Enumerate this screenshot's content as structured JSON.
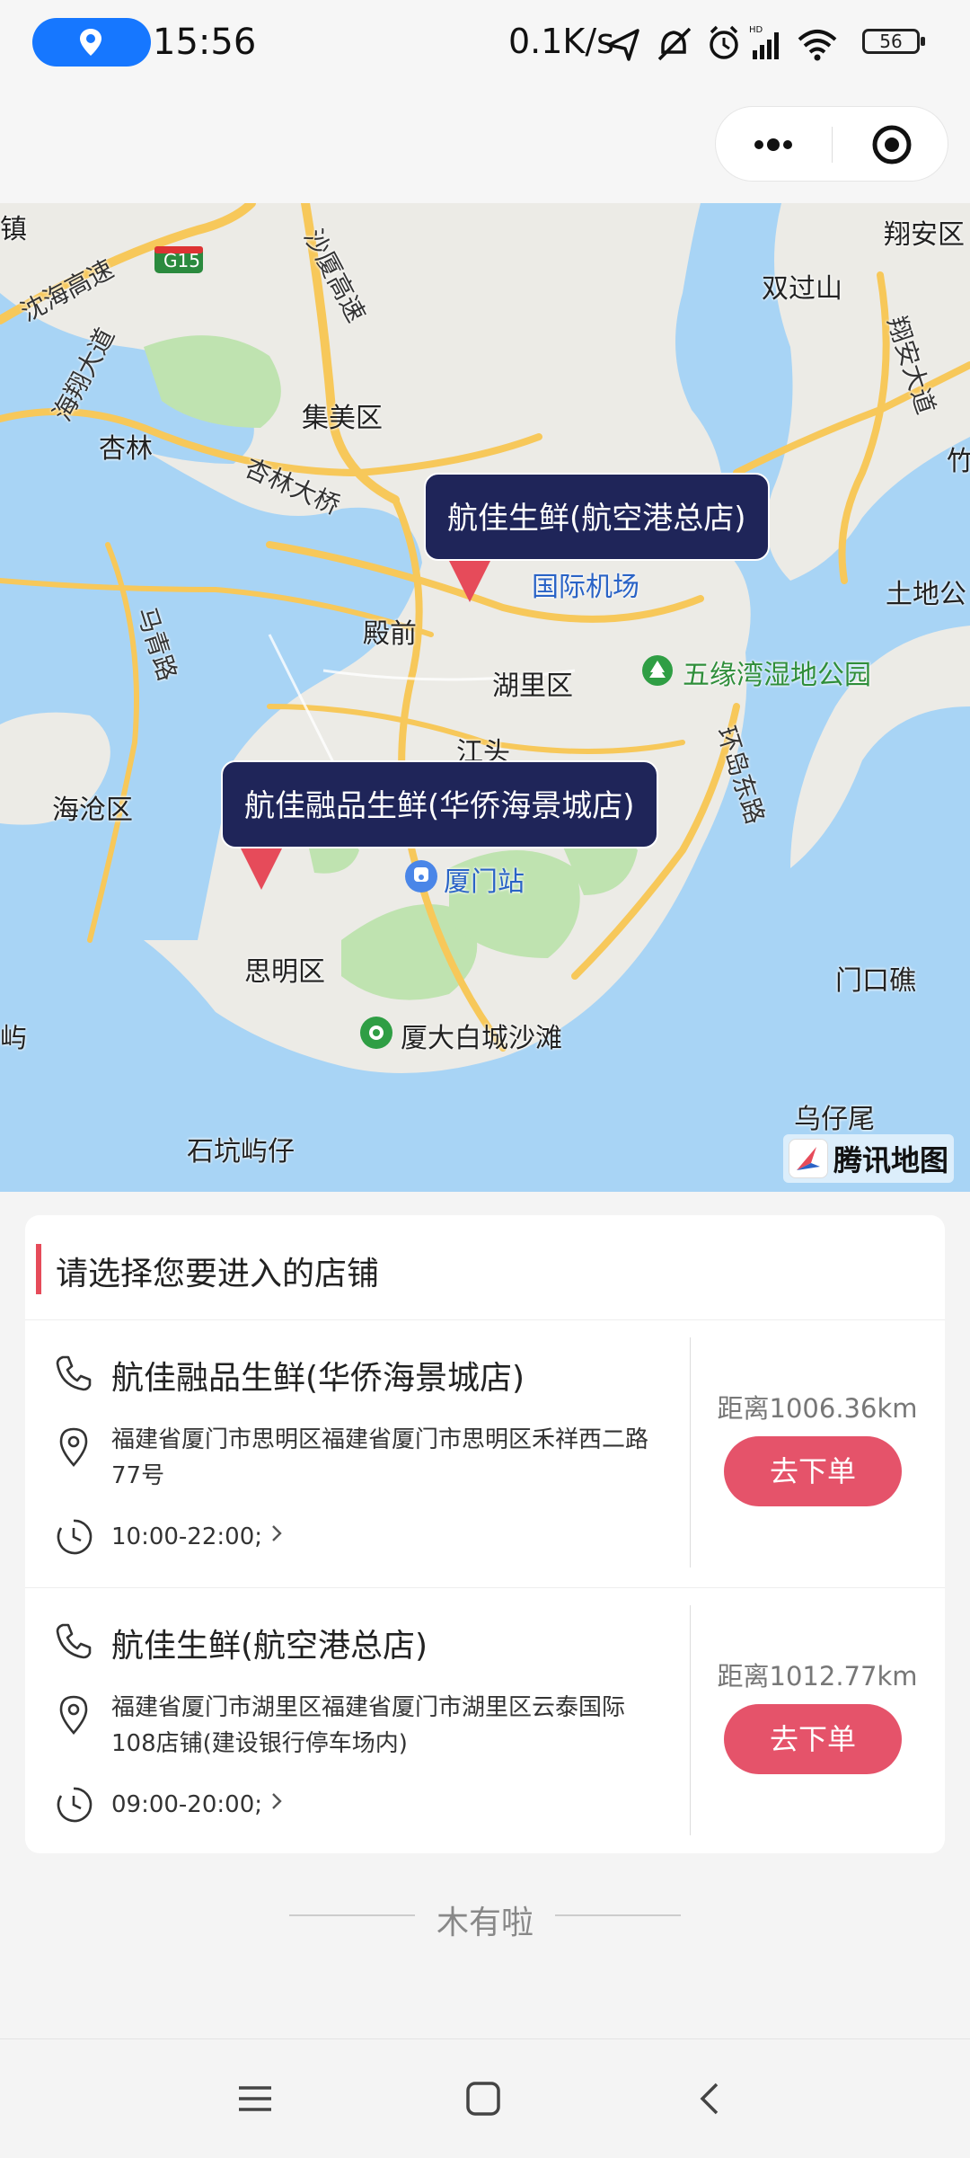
{
  "status_bar": {
    "time": "15:56",
    "net_speed": "0.1K/s",
    "battery": "56",
    "icons": [
      "location-arrow-icon",
      "mute-icon",
      "alarm-icon",
      "signal-icon",
      "wifi-icon",
      "battery-icon"
    ]
  },
  "header": {
    "more_icon": "more-dots-icon",
    "close_icon": "target-circle-icon"
  },
  "map": {
    "labels": {
      "xiangan_district": "翔安区",
      "shuangguoshan": "双过山",
      "jimei_district": "集美区",
      "xinglin": "杏林",
      "xinglin_bridge": "杏林大桥",
      "airport": "国际机场",
      "dianqian": "殿前",
      "huli_district": "湖里区",
      "wuyuanwan_park": "五缘湾湿地公园",
      "jiangtou": "江头",
      "haicang_district": "海沧区",
      "xiamen_station": "厦门站",
      "siming_district": "思明区",
      "xiada_beach": "厦大白城沙滩",
      "menkoujiao": "门口礁",
      "wuzaiwei": "乌仔尾",
      "shikeng": "石坑屿仔",
      "tudigong": "土地公",
      "shenhai_expressway": "沈海高速",
      "xiangan_avenue": "翔安大道",
      "xiangtian": "海翔大道",
      "maqing_road": "马青路",
      "huandao_east": "环岛东路",
      "xiasha_expressway": "沙厦高速",
      "g15": "G15",
      "edge_zhen": "镇",
      "edge_yu": "屿",
      "edge_zhu": "竹"
    },
    "callouts": [
      "航佳生鲜(航空港总店)",
      "航佳融品生鲜(华侨海景城店)"
    ],
    "watermark": "腾讯地图",
    "colors": {
      "water": "#a8d4f5",
      "land": "#ecebe6",
      "road_major": "#f7c85a",
      "green": "#bfe3b0",
      "callout_bg": "#1f2559",
      "pin": "#e64b5a"
    }
  },
  "list": {
    "title": "请选择您要进入的店铺",
    "stores": [
      {
        "name": "航佳融品生鲜(华侨海景城店)",
        "address": "福建省厦门市思明区福建省厦门市思明区禾祥西二路77号",
        "hours": "10:00-22:00;",
        "distance": "距离1006.36km",
        "button": "去下单"
      },
      {
        "name": "航佳生鲜(航空港总店)",
        "address": "福建省厦门市湖里区福建省厦门市湖里区云泰国际108店铺(建设银行停车场内)",
        "hours": "09:00-20:00;",
        "distance": "距离1012.77km",
        "button": "去下单"
      }
    ],
    "end_text": "木有啦"
  },
  "navbar": {
    "icons": [
      "menu-icon",
      "home-square-icon",
      "back-chevron-icon"
    ]
  },
  "accent": "#e5536a"
}
